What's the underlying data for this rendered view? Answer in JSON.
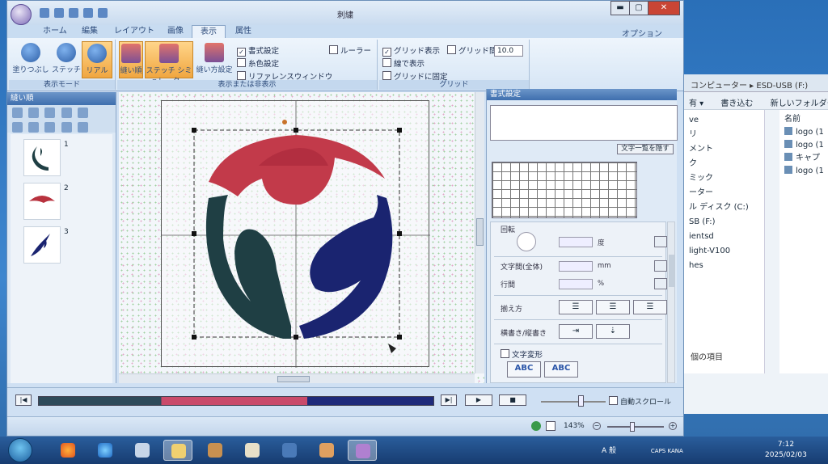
{
  "app": {
    "title": "刺繍"
  },
  "titlebar": {
    "minimize": "▬",
    "maximize": "▢",
    "close": "✕"
  },
  "tabs": [
    "ホーム",
    "編集",
    "レイアウト",
    "画像",
    "表示",
    "属性"
  ],
  "options_label": "オプション",
  "ribbon": {
    "mode_group": {
      "label": "表示モード",
      "buttons": [
        "塗りつぶし",
        "ステッチ",
        "リアル"
      ]
    },
    "display_group": {
      "label": "表示または非表示",
      "buttons": [
        "縫い順",
        "ステッチ シミュレーター",
        "縫い方設定"
      ],
      "checks": [
        {
          "label": "書式設定",
          "checked": true
        },
        {
          "label": "糸色設定",
          "checked": false
        },
        {
          "label": "リファレンスウィンドウ",
          "checked": false
        },
        {
          "label": "ルーラー",
          "checked": false
        }
      ]
    },
    "grid_group": {
      "label": "グリッド",
      "show_grid": "グリッド表示",
      "grid_spacing_label": "グリッド間隔",
      "grid_spacing_value": "10.0",
      "line_display": "線で表示",
      "snap": "グリッドに固定"
    }
  },
  "left_panel": {
    "title": "縫い順",
    "items": [
      {
        "num": "1",
        "color": "#1f3f44"
      },
      {
        "num": "2",
        "color": "#b8323e"
      },
      {
        "num": "3",
        "color": "#1a2470"
      }
    ]
  },
  "right_panel": {
    "title": "書式設定",
    "charlist_button": "文字一覧を隠す",
    "rotation_label": "回転",
    "rotation_unit": "度",
    "spacing_label": "文字間(全体)",
    "spacing_unit": "mm",
    "line_label": "行間",
    "line_unit": "%",
    "align_label": "揃え方",
    "direction_label": "横書き/縦書き",
    "transform_label": "文字変形",
    "transform_samples": [
      "ABC",
      "ABC"
    ]
  },
  "playback": {
    "autoscroll_label": "自動スクロール",
    "progress_fraction": 1.0
  },
  "status": {
    "zoom": "143%"
  },
  "design": {
    "colors": {
      "red": "#c23a4a",
      "teal": "#1f3f44",
      "navy": "#1a2470"
    }
  },
  "background_window": {
    "address": "コンピューター ▸ ESD-USB (F:)",
    "toolbar": [
      "有 ▾",
      "書き込む",
      "新しいフォルダー"
    ],
    "nav": [
      "ve",
      "リ",
      "メント",
      "",
      "ク",
      "ミック",
      "",
      "ーター",
      "ル ディスク (C:)",
      "SB (F:)",
      "ientsd",
      "light-V100",
      "hes"
    ],
    "column_header": "名前",
    "files": [
      "logo (1",
      "logo (1",
      "キャプ",
      "logo (1"
    ],
    "status": "個の項目"
  },
  "tray": {
    "ime": "A 般",
    "caps": "CAPS KANA",
    "time": "7:12",
    "date": "2025/02/03"
  }
}
